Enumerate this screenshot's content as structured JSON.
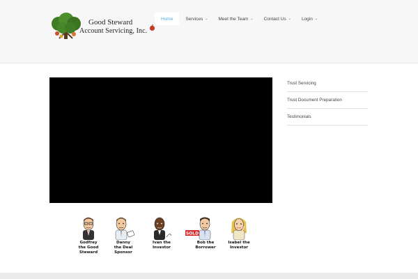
{
  "logo": {
    "line1": "Good Steward",
    "line2": "Account Servicing, Inc."
  },
  "nav": {
    "items": [
      {
        "label": "Home",
        "active": true,
        "dropdown": false
      },
      {
        "label": "Services",
        "active": false,
        "dropdown": true
      },
      {
        "label": "Meet the Team",
        "active": false,
        "dropdown": true
      },
      {
        "label": "Contact Us",
        "active": false,
        "dropdown": true
      },
      {
        "label": "Login",
        "active": false,
        "dropdown": true
      }
    ],
    "caret": "⌄"
  },
  "sidebar": {
    "items": [
      "Trust Servicing",
      "Trust Document Preparation",
      "Testimonials"
    ]
  },
  "team": {
    "members": [
      {
        "name": "Godfrey\nthe Good\nSteward"
      },
      {
        "name": "Danny\nthe Deal\nSponsor"
      },
      {
        "name": "Ivan the\nInvestor"
      },
      {
        "name": "Bob the\nBorrower",
        "sign": "SOLD"
      },
      {
        "name": "Isabel the\nInvestor"
      }
    ]
  },
  "colors": {
    "accent": "#47b1d6",
    "header_bg": "#f7f7f7",
    "video_bg": "#000000"
  }
}
